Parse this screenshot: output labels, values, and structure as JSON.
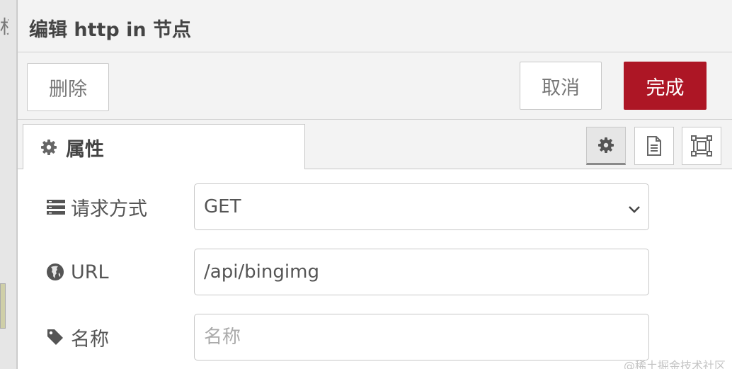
{
  "background_fragment": "权",
  "dialog": {
    "title": "编辑 http in 节点",
    "delete_label": "删除",
    "cancel_label": "取消",
    "done_label": "完成"
  },
  "tabs": {
    "properties_label": "属性"
  },
  "tool_icons": [
    "gear-icon",
    "document-icon",
    "frame-icon"
  ],
  "form": {
    "method": {
      "label": "请求方式",
      "value": "GET",
      "icon": "list-icon"
    },
    "url": {
      "label": "URL",
      "value": "/api/bingimg",
      "icon": "globe-icon"
    },
    "name": {
      "label": "名称",
      "value": "",
      "placeholder": "名称",
      "icon": "tag-icon"
    }
  },
  "watermark": "@稀土掘金技术社区",
  "colors": {
    "accent": "#ad1625",
    "background": "#f3f3f3",
    "border": "#c8c8c8"
  }
}
